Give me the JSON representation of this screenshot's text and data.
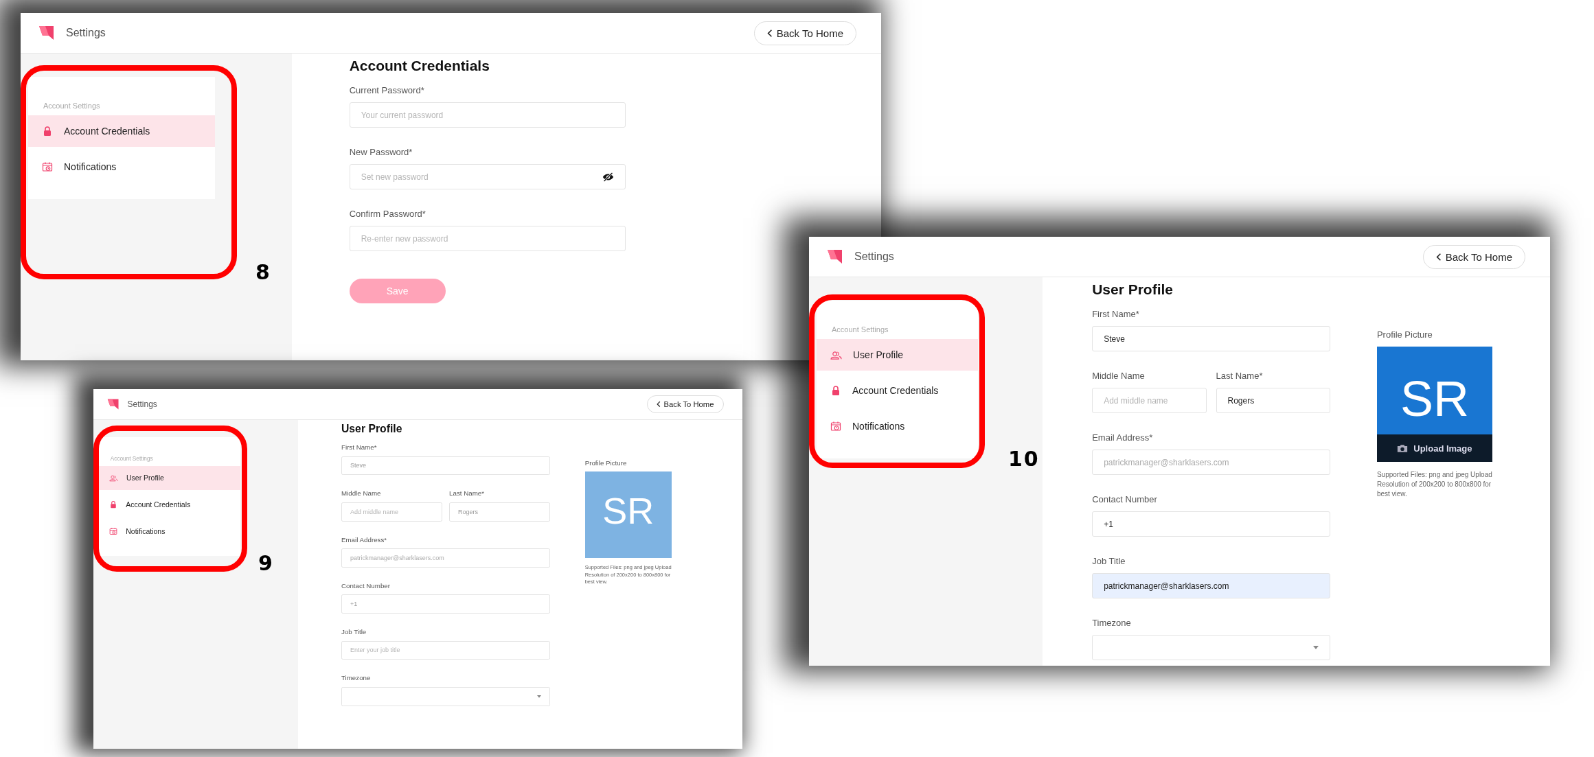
{
  "panels": [
    {
      "annotation": "8",
      "header": {
        "title": "Settings",
        "back_button": "Back To Home"
      },
      "sidebar": {
        "section": "Account Settings",
        "items": [
          {
            "label": "Account Credentials",
            "kind": "credentials",
            "selected": true
          },
          {
            "label": "Notifications",
            "kind": "notifications",
            "selected": false
          }
        ]
      },
      "page_title": "Account Credentials",
      "dimmed": false,
      "fields": [
        {
          "kind": "input",
          "label": "Current Password*",
          "placeholder": "Your current password"
        },
        {
          "kind": "input",
          "label": "New Password*",
          "placeholder": "Set new password",
          "visibility_toggle": true
        },
        {
          "kind": "input",
          "label": "Confirm Password*",
          "placeholder": "Re-enter new password"
        }
      ],
      "save_button": {
        "label": "Save",
        "disabled": true
      }
    },
    {
      "annotation": "9",
      "header": {
        "title": "Settings",
        "back_button": "Back To Home"
      },
      "sidebar": {
        "section": "Account Settings",
        "items": [
          {
            "label": "User Profile",
            "kind": "profile",
            "selected": true
          },
          {
            "label": "Account Credentials",
            "kind": "credentials",
            "selected": false
          },
          {
            "label": "Notifications",
            "kind": "notifications",
            "selected": false
          }
        ]
      },
      "page_title": "User Profile",
      "dimmed": true,
      "fields": [
        {
          "kind": "input",
          "label": "First Name*",
          "value": "Steve"
        },
        {
          "kind": "pair",
          "fields": [
            {
              "label": "Middle Name",
              "placeholder": "Add middle name"
            },
            {
              "label": "Last Name*",
              "value": "Rogers"
            }
          ]
        },
        {
          "kind": "input",
          "label": "Email Address*",
          "value": "patrickmanager@sharklasers.com",
          "disabled": true
        },
        {
          "kind": "input",
          "label": "Contact Number",
          "value": "+1"
        },
        {
          "kind": "input",
          "label": "Job Title",
          "placeholder": "Enter your job title"
        },
        {
          "kind": "select",
          "label": "Timezone"
        }
      ],
      "avatar": {
        "label": "Profile Picture",
        "initials": "SR",
        "caption": "Supported Files: png and jpeg Upload Resolution of 200x200 to 800x800 for best view."
      }
    },
    {
      "annotation": "10",
      "header": {
        "title": "Settings",
        "back_button": "Back To Home"
      },
      "sidebar": {
        "section": "Account Settings",
        "items": [
          {
            "label": "User Profile",
            "kind": "profile",
            "selected": true
          },
          {
            "label": "Account Credentials",
            "kind": "credentials",
            "selected": false
          },
          {
            "label": "Notifications",
            "kind": "notifications",
            "selected": false
          }
        ]
      },
      "page_title": "User Profile",
      "dimmed": false,
      "fields": [
        {
          "kind": "input",
          "label": "First Name*",
          "value": "Steve"
        },
        {
          "kind": "pair",
          "fields": [
            {
              "label": "Middle Name",
              "placeholder": "Add middle name"
            },
            {
              "label": "Last Name*",
              "value": "Rogers"
            }
          ]
        },
        {
          "kind": "input",
          "label": "Email Address*",
          "value": "patrickmanager@sharklasers.com",
          "disabled": true
        },
        {
          "kind": "input",
          "label": "Contact Number",
          "value": "+1"
        },
        {
          "kind": "input",
          "label": "Job Title",
          "value": "patrickmanager@sharklasers.com",
          "autofilled": true
        },
        {
          "kind": "select",
          "label": "Timezone"
        }
      ],
      "avatar": {
        "label": "Profile Picture",
        "initials": "SR",
        "upload_label": "Upload Image",
        "caption": "Supported Files: png and jpeg Upload Resolution of 200x200 to 800x800 for best view."
      }
    }
  ]
}
